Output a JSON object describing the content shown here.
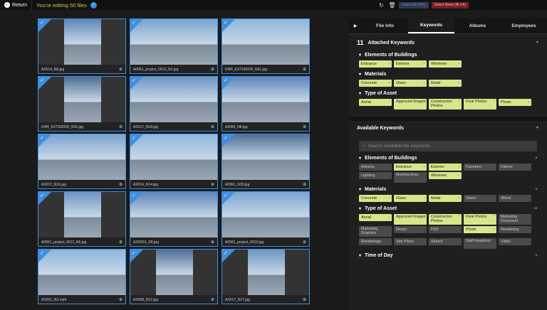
{
  "topbar": {
    "return_label": "Return",
    "editing_text": "You're editing 50 files",
    "select_all": "Select All (⌘A)",
    "select_none": "Select None (⌘⇧A)"
  },
  "tabs": [
    "File Info",
    "Keywords",
    "Albums",
    "Employees"
  ],
  "attached": {
    "count": "11",
    "title": "Attached Keywords"
  },
  "attached_groups": [
    {
      "title": "Elements of Buildings",
      "chips": [
        "Entrance",
        "Exterior",
        "Windows"
      ]
    },
    {
      "title": "Materials",
      "chips": [
        "Concrete",
        "Glass",
        "Metal"
      ]
    },
    {
      "title": "Type of Asset",
      "chips": [
        "Aerial",
        "Approved Images",
        "Construction Photos",
        "Final Photos",
        "Photo"
      ]
    }
  ],
  "available": {
    "title": "Available Keywords",
    "search_placeholder": "Search available file keywords"
  },
  "available_groups": [
    {
      "title": "Elements of Buildings",
      "count": "8",
      "chips": [
        {
          "l": "Atriums",
          "on": false
        },
        {
          "l": "Entrance",
          "on": true
        },
        {
          "l": "Exterior",
          "on": true
        },
        {
          "l": "Furniture",
          "on": false
        },
        {
          "l": "Interior",
          "on": false
        },
        {
          "l": "Lighting",
          "on": false
        },
        {
          "l": "Meeting Area",
          "on": false
        },
        {
          "l": "Windows",
          "on": true
        }
      ]
    },
    {
      "title": "Materials",
      "count": "5",
      "chips": [
        {
          "l": "Concrete",
          "on": true
        },
        {
          "l": "Glass",
          "on": true
        },
        {
          "l": "Metal",
          "on": true
        },
        {
          "l": "Stone",
          "on": false
        },
        {
          "l": "Wood",
          "on": false
        }
      ]
    },
    {
      "title": "Type of Asset",
      "count": "15",
      "chips": [
        {
          "l": "Aerial",
          "on": true
        },
        {
          "l": "Approved Images",
          "on": true
        },
        {
          "l": "Construction Photos",
          "on": true
        },
        {
          "l": "Final Photos",
          "on": true
        },
        {
          "l": "Marketing Document",
          "on": false
        },
        {
          "l": "Marketing Graphics",
          "on": false
        },
        {
          "l": "Model",
          "on": false
        },
        {
          "l": "PDF",
          "on": false
        },
        {
          "l": "Photo",
          "on": true
        },
        {
          "l": "Rendering",
          "on": false
        },
        {
          "l": "Renderings",
          "on": false
        },
        {
          "l": "Site Plans",
          "on": false
        },
        {
          "l": "Sketch",
          "on": false
        },
        {
          "l": "Staff Headshot",
          "on": false
        },
        {
          "l": "Video",
          "on": false
        }
      ]
    },
    {
      "title": "Time of Day",
      "count": "5",
      "chips": []
    }
  ],
  "files": [
    "AX014_N8.jpg",
    "A0061_project_0012_N2.jpg",
    "DHR_EXTERIOR_N31.jpg",
    "DHR_EXTERIOR_N32.jpg",
    "AX017_N18.jpg",
    "A0085_N8.jpg",
    "AX017_N16.jpg",
    "AX014_N14.jpg",
    "A0061_N29.jpg",
    "A0061_project_0012_N5.jpg",
    "AXD001_N5.jpg",
    "A0061_project_0012.jpg",
    "AX001_N2.mp4",
    "AX098_N12.jpg",
    "AX017_N17.jpg"
  ],
  "colors": {
    "accent": "#3e8fe0",
    "chip": "#d6e78a",
    "editing": "#e2c44b"
  }
}
